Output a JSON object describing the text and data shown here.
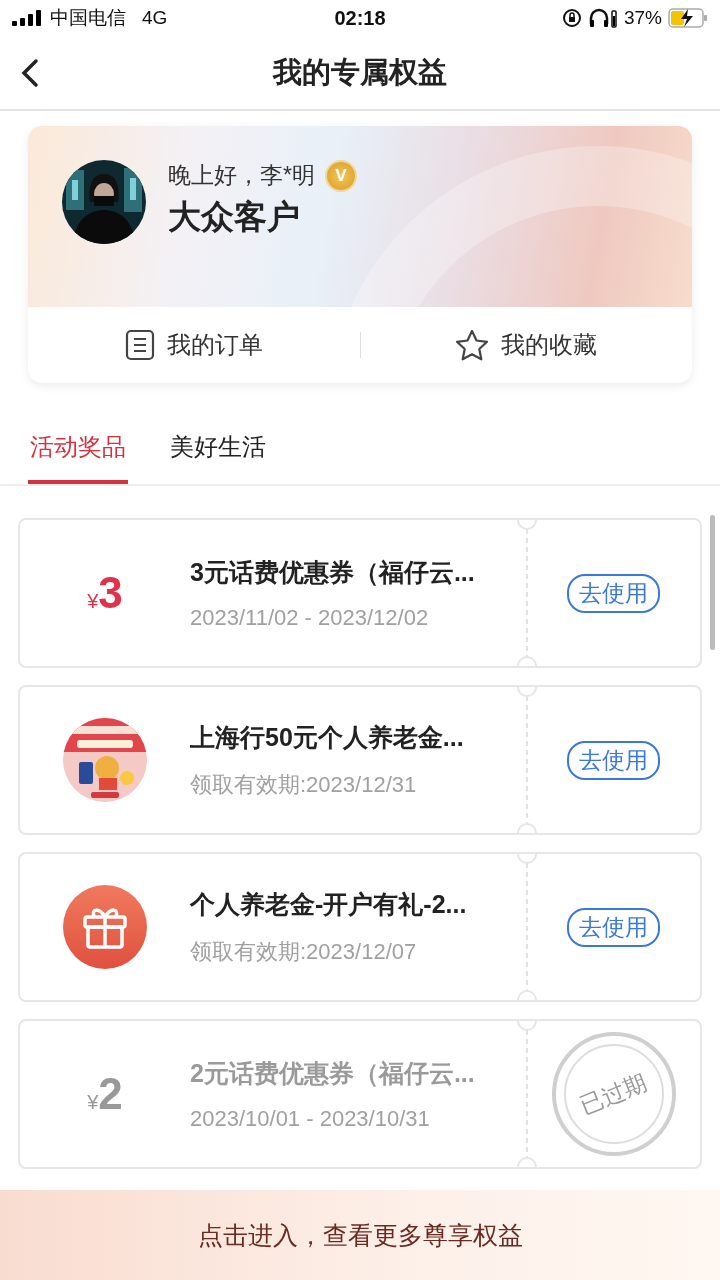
{
  "status_bar": {
    "carrier": "中国电信",
    "network": "4G",
    "time": "02:18",
    "battery": "37%"
  },
  "header": {
    "title": "我的专属权益"
  },
  "profile": {
    "greeting": "晚上好，李*明",
    "badge": "V",
    "level": "大众客户",
    "links": [
      {
        "kind": "order",
        "label": "我的订单"
      },
      {
        "kind": "favorite",
        "label": "我的收藏"
      }
    ]
  },
  "tabs": [
    {
      "label": "活动奖品",
      "selected": true
    },
    {
      "label": "美好生活",
      "selected": false
    }
  ],
  "coupons": [
    {
      "kind": "amount",
      "currency": "¥",
      "value": "3",
      "title": "3元话费优惠券（福仔云...",
      "validity": "2023/11/02 - 2023/12/02",
      "expired": false,
      "action": "去使用"
    },
    {
      "kind": "picture",
      "title": "上海行50元个人养老金...",
      "validity": "领取有效期:2023/12/31",
      "expired": false,
      "action": "去使用"
    },
    {
      "kind": "gift",
      "title": "个人养老金-开户有礼-2...",
      "validity": "领取有效期:2023/12/07",
      "expired": false,
      "action": "去使用"
    },
    {
      "kind": "amount",
      "currency": "¥",
      "value": "2",
      "title": "2元话费优惠券（福仔云...",
      "validity": "2023/10/01 - 2023/10/31",
      "expired": true,
      "action": "已过期"
    }
  ],
  "footer": {
    "text": "点击进入，查看更多尊享权益"
  }
}
